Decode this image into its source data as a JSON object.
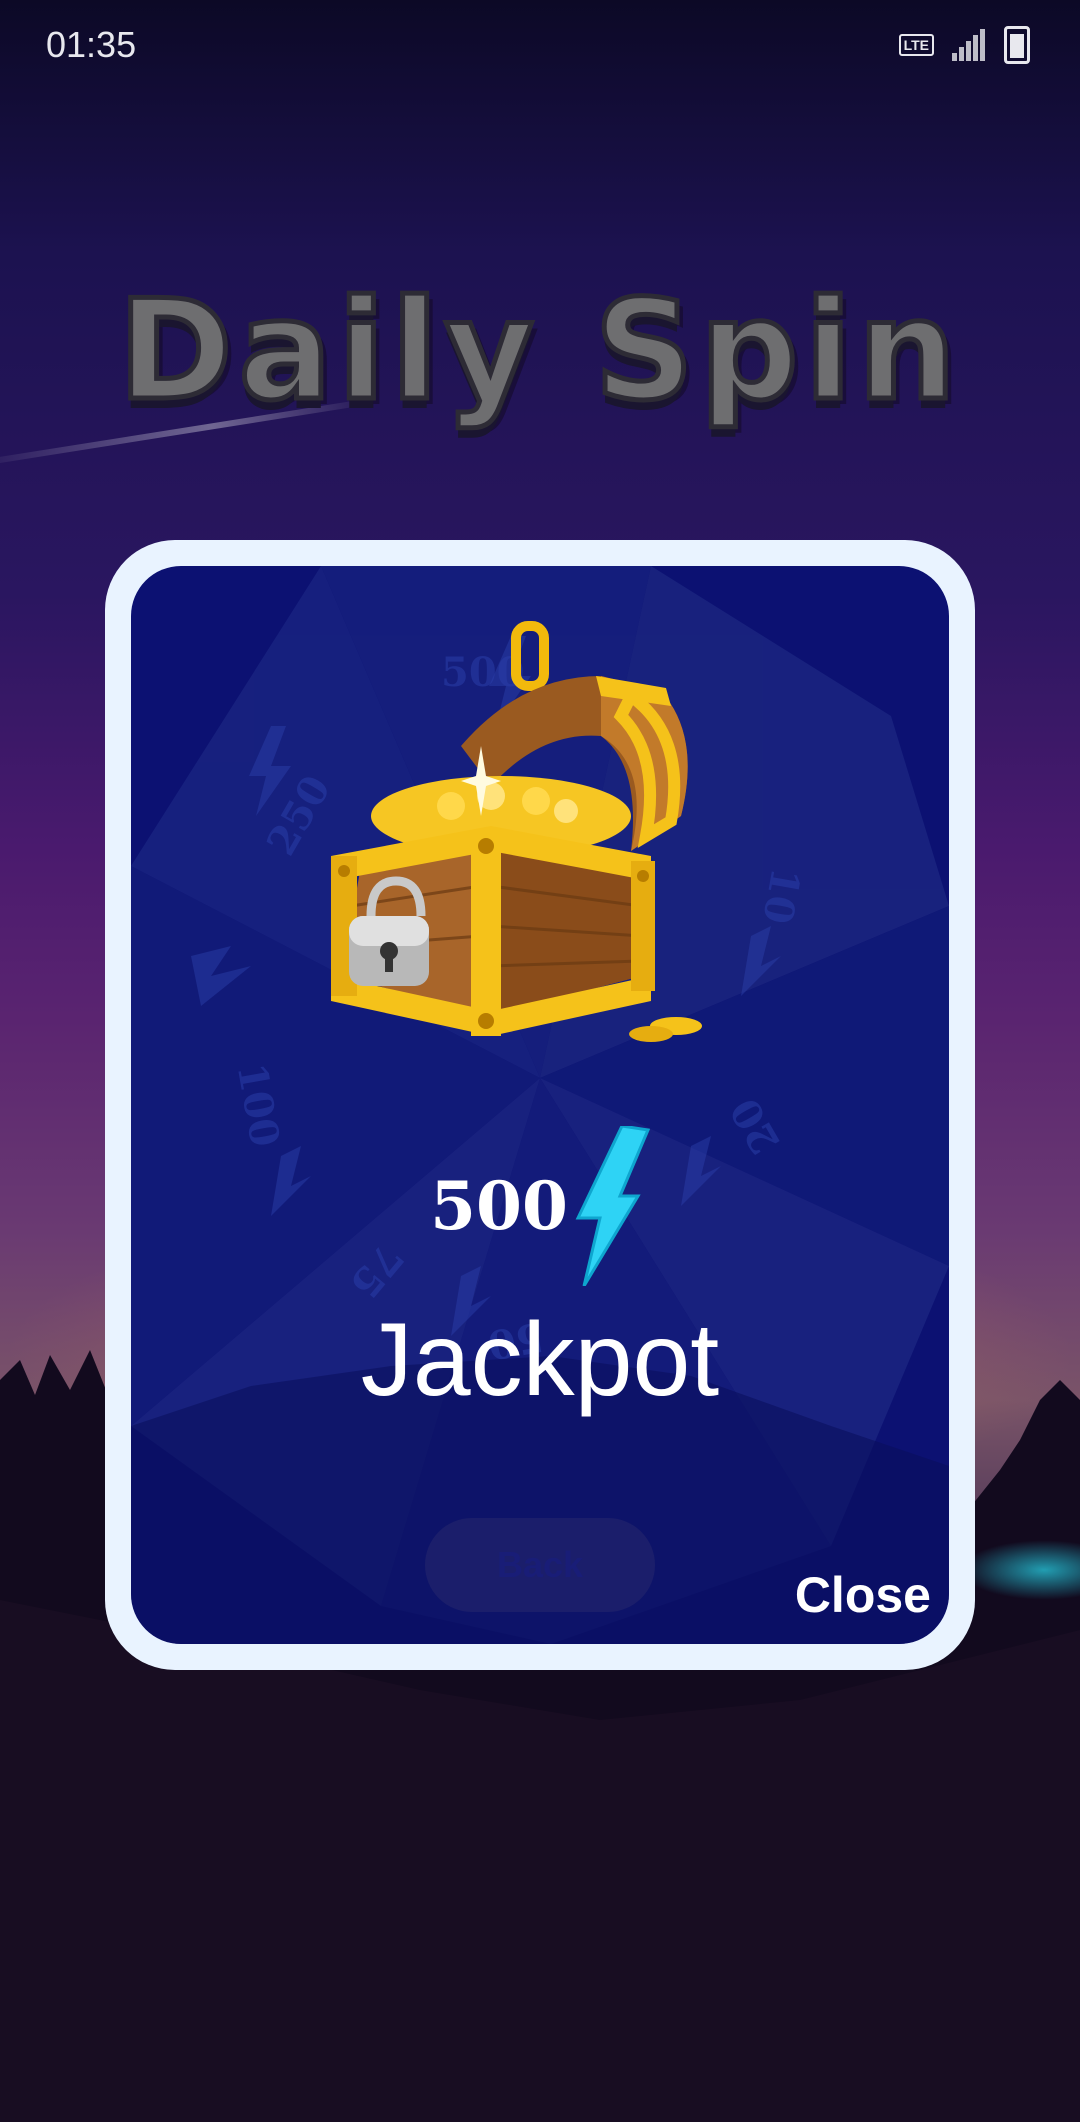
{
  "status_bar": {
    "time": "01:35",
    "network_label": "LTE",
    "icons": [
      "lte-icon",
      "signal-icon",
      "battery-charging-icon"
    ]
  },
  "title": "Daily Spin",
  "wheel": {
    "segment_values": [
      "500",
      "250",
      "100",
      "75",
      "50",
      "20",
      "10"
    ],
    "segment_icon": "lightning-bolt-icon"
  },
  "reward": {
    "image": "treasure-chest-icon",
    "amount": "500",
    "amount_icon": "lightning-bolt-icon",
    "label": "Jackpot"
  },
  "buttons": {
    "back_label": "Back",
    "close_label": "Close"
  },
  "colors": {
    "dialog_border": "#e9f3ff",
    "dialog_fill": "#0c1172",
    "bolt": "#2ed3f5"
  }
}
